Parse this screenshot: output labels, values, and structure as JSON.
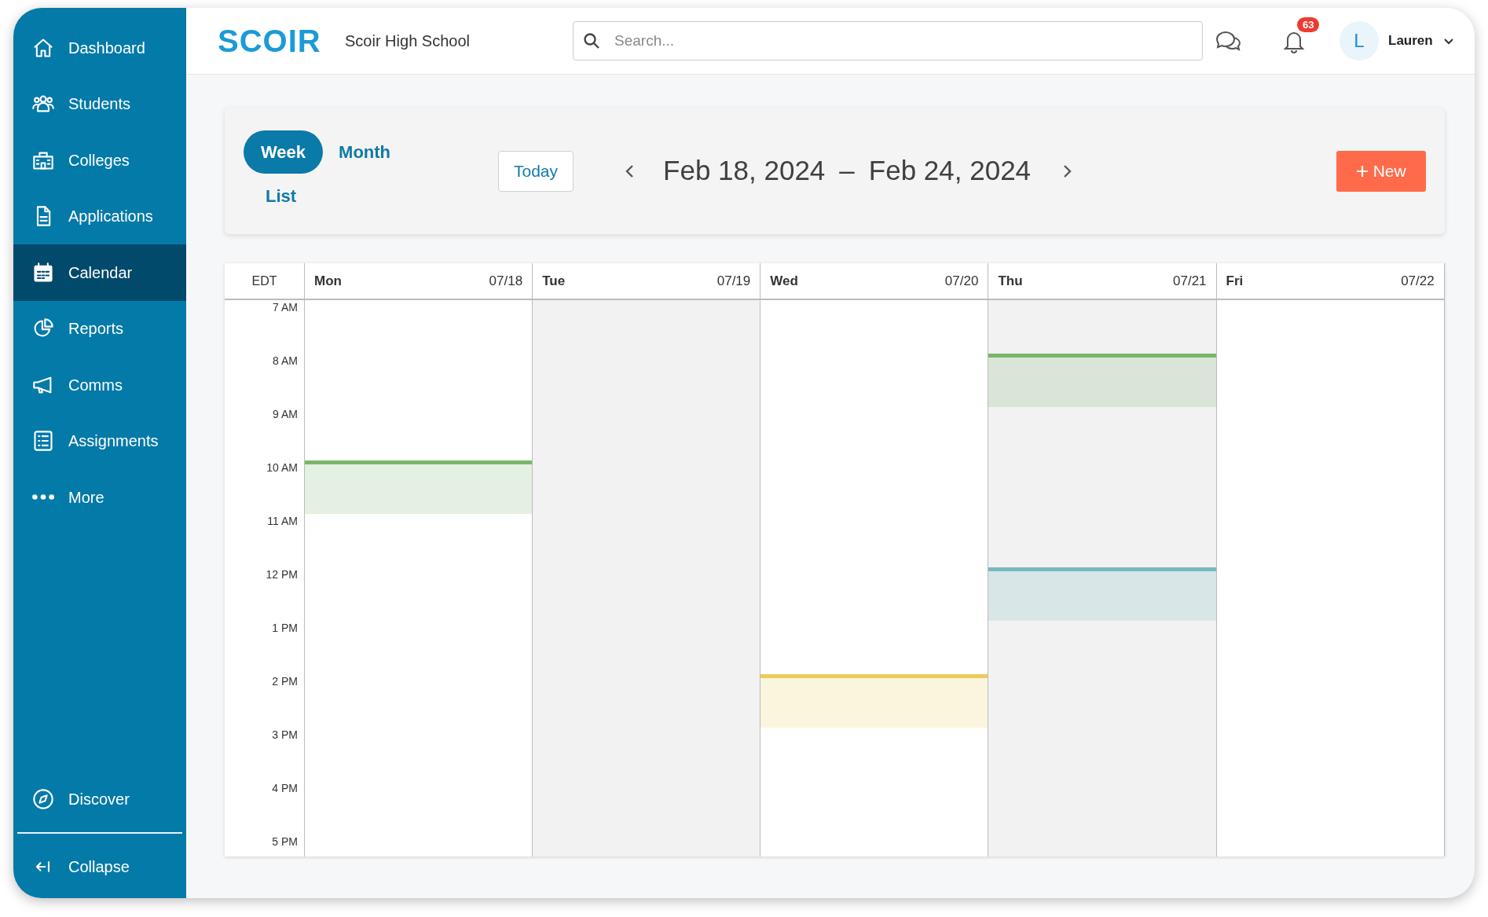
{
  "sidebar": {
    "items": [
      {
        "label": "Dashboard",
        "selected": false
      },
      {
        "label": "Students",
        "selected": false
      },
      {
        "label": "Colleges",
        "selected": false
      },
      {
        "label": "Applications",
        "selected": false
      },
      {
        "label": "Calendar",
        "selected": true
      },
      {
        "label": "Reports",
        "selected": false
      },
      {
        "label": "Comms",
        "selected": false
      },
      {
        "label": "Assignments",
        "selected": false
      },
      {
        "label": "More",
        "selected": false
      }
    ],
    "footer": [
      {
        "label": "Discover"
      },
      {
        "label": "Collapse"
      }
    ]
  },
  "header": {
    "logo": "SCOIR",
    "school": "Scoir High School",
    "search": {
      "placeholder": "Search..."
    },
    "notifications": "63",
    "user": {
      "initial": "L",
      "name": "Lauren"
    }
  },
  "toolbar": {
    "views": [
      {
        "label": "Week",
        "selected": true
      },
      {
        "label": "Month",
        "selected": false
      },
      {
        "label": "List",
        "selected": false
      }
    ],
    "today": "Today",
    "range": {
      "start": "Feb 18, 2024",
      "separator": "–",
      "end": "Feb 24, 2024"
    },
    "new_button": "New"
  },
  "calendar": {
    "timezone": "EDT",
    "days": [
      {
        "name": "Mon",
        "date": "07/18",
        "shaded": false
      },
      {
        "name": "Tue",
        "date": "07/19",
        "shaded": true
      },
      {
        "name": "Wed",
        "date": "07/20",
        "shaded": false
      },
      {
        "name": "Thu",
        "date": "07/21",
        "shaded": true
      },
      {
        "name": "Fri",
        "date": "07/22",
        "shaded": false
      }
    ],
    "rows": [
      {
        "time": "7 AM",
        "cells": [
          {
            "event": false
          },
          {
            "event": false
          },
          {
            "event": false
          },
          {
            "event": false
          },
          {
            "event": false
          }
        ]
      },
      {
        "time": "8 AM",
        "cells": [
          {
            "event": false
          },
          {
            "event": false
          },
          {
            "event": false
          },
          {
            "event": true,
            "color": "#79b66a"
          },
          {
            "event": false
          }
        ]
      },
      {
        "time": "9 AM",
        "cells": [
          {
            "event": false
          },
          {
            "event": false
          },
          {
            "event": false
          },
          {
            "event": false
          },
          {
            "event": false
          }
        ]
      },
      {
        "time": "10 AM",
        "cells": [
          {
            "event": true,
            "color": "#79b66a"
          },
          {
            "event": false
          },
          {
            "event": false
          },
          {
            "event": false
          },
          {
            "event": false
          }
        ]
      },
      {
        "time": "11 AM",
        "cells": [
          {
            "event": false
          },
          {
            "event": false
          },
          {
            "event": false
          },
          {
            "event": false
          },
          {
            "event": false
          }
        ]
      },
      {
        "time": "12 PM",
        "cells": [
          {
            "event": false
          },
          {
            "event": false
          },
          {
            "event": false
          },
          {
            "event": true,
            "color": "#78b9bf"
          },
          {
            "event": false
          }
        ]
      },
      {
        "time": "1 PM",
        "cells": [
          {
            "event": false
          },
          {
            "event": false
          },
          {
            "event": false
          },
          {
            "event": false
          },
          {
            "event": false
          }
        ]
      },
      {
        "time": "2 PM",
        "cells": [
          {
            "event": false
          },
          {
            "event": false
          },
          {
            "event": true,
            "color": "#eccb5c"
          },
          {
            "event": false
          },
          {
            "event": false
          }
        ]
      },
      {
        "time": "3 PM",
        "cells": [
          {
            "event": false
          },
          {
            "event": false
          },
          {
            "event": false
          },
          {
            "event": false
          },
          {
            "event": false
          }
        ]
      },
      {
        "time": "4 PM",
        "cells": [
          {
            "event": false
          },
          {
            "event": false
          },
          {
            "event": false
          },
          {
            "event": false
          },
          {
            "event": false
          }
        ]
      },
      {
        "time": "5 PM",
        "cells": [
          {
            "event": false
          },
          {
            "event": false
          },
          {
            "event": false
          },
          {
            "event": false
          },
          {
            "event": false
          }
        ]
      }
    ]
  }
}
